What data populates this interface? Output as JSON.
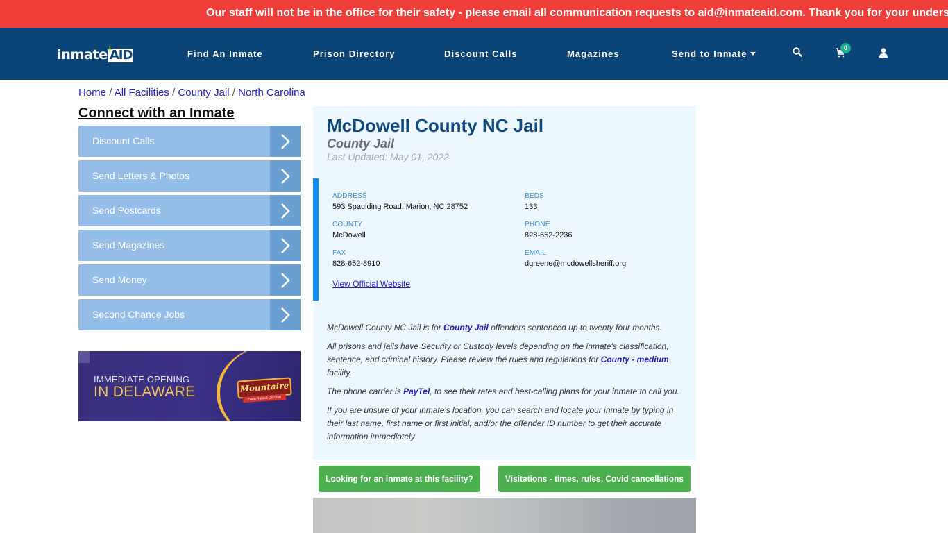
{
  "alert": {
    "message": "Our staff will not be in the office for their safety - please email all communication requests to aid@inmateaid.com. Thank you for your understanding."
  },
  "navbar": {
    "logo_part1": "inmate",
    "logo_part2": "AID",
    "links": [
      {
        "label": "Find An Inmate"
      },
      {
        "label": "Prison Directory"
      },
      {
        "label": "Discount Calls"
      },
      {
        "label": "Magazines"
      },
      {
        "label": "Send to Inmate",
        "has_dropdown": true
      }
    ],
    "icons": [
      "search-icon",
      "cart-icon",
      "user-icon"
    ],
    "cart_count": "0"
  },
  "breadcrumb": [
    {
      "label": "Home"
    },
    {
      "label": "All Facilities"
    },
    {
      "label": "County Jail"
    },
    {
      "label": "North Carolina"
    }
  ],
  "breadcrumb_separator": "/",
  "sidebar": {
    "title": "Connect with an Inmate",
    "items": [
      {
        "label": "Discount Calls"
      },
      {
        "label": "Send Letters & Photos"
      },
      {
        "label": "Send Postcards"
      },
      {
        "label": "Send Magazines"
      },
      {
        "label": "Send Money"
      },
      {
        "label": "Second Chance Jobs"
      }
    ],
    "ad": {
      "line1": "IMMEDIATE OPENING",
      "line2": "IN DELAWARE",
      "brand": "Mountaire",
      "brand_tagline": "Farm Raised Chicken"
    }
  },
  "facility": {
    "name": "McDowell County NC Jail",
    "type": "County Jail",
    "last_updated": "Last Updated: May 01, 2022",
    "fields": {
      "address": {
        "label": "ADDRESS",
        "value": "593 Spaulding Road, Marion, NC 28752"
      },
      "beds": {
        "label": "BEDS",
        "value": "133"
      },
      "county": {
        "label": "COUNTY",
        "value": "McDowell"
      },
      "phone": {
        "label": "PHONE",
        "value": "828-652-2236"
      },
      "fax": {
        "label": "FAX",
        "value": "828-652-8910"
      },
      "email": {
        "label": "EMAIL",
        "value": "dgreene@mcdowellsheriff.org"
      }
    },
    "website_link": "View Official Website",
    "description": {
      "p1_before": "McDowell County NC Jail is for ",
      "p1_link": "County Jail",
      "p1_after": " offenders sentenced up to twenty four months.",
      "p2_before": "All prisons and jails have Security or Custody levels depending on the inmate's classification, sentence, and criminal history. Please review the rules and regulations for ",
      "p2_link": "County - medium",
      "p2_after": " facility.",
      "p3_before": "The phone carrier is ",
      "p3_link": "PayTel",
      "p3_after": ", to see their rates and best-calling plans for your inmate to call you.",
      "p4": "If you are unsure of your inmate's location, you can search and locate your inmate by typing in their last name, first name or first initial, and/or the offender ID number to get their accurate information immediately"
    }
  },
  "actions": {
    "find_inmate": "Looking for an inmate at this facility?",
    "visitation": "Visitations - times, rules, Covid cancellations"
  },
  "colors": {
    "alert_bg": "#ef3e3a",
    "navbar_bg": "#0b4477",
    "sidebar_item": "#94bee7",
    "sidebar_arrow": "#6a9fd2",
    "card_bg": "#ecf7fe",
    "accent_blue": "#0d8ef0",
    "button_green": "#4caf50",
    "cart_badge": "#1fae8e"
  }
}
